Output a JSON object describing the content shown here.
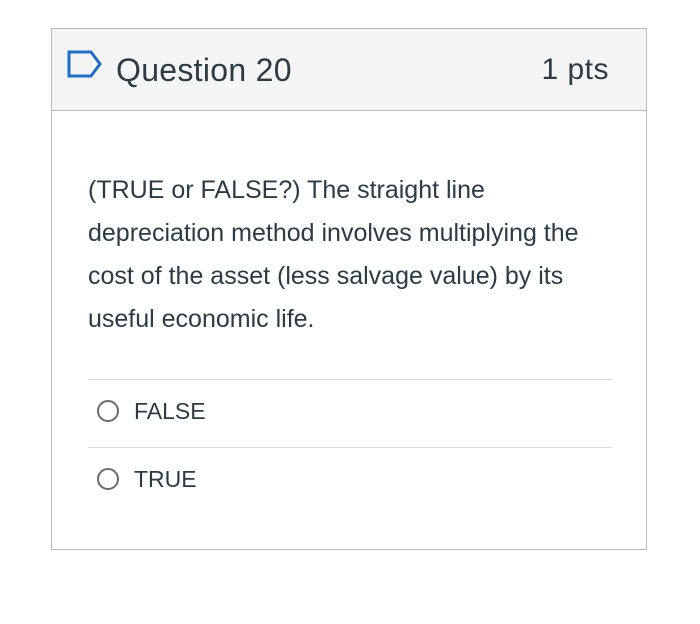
{
  "question": {
    "title": "Question 20",
    "points": "1 pts",
    "flag_icon": "flag-outline-icon",
    "flag_color": "#1f6fc5",
    "text": "(TRUE or FALSE?) The straight line depreciation method involves multiplying the cost of the asset (less salvage value) by its useful economic life.",
    "answers": [
      {
        "label": "FALSE",
        "selected": false
      },
      {
        "label": "TRUE",
        "selected": false
      }
    ]
  }
}
